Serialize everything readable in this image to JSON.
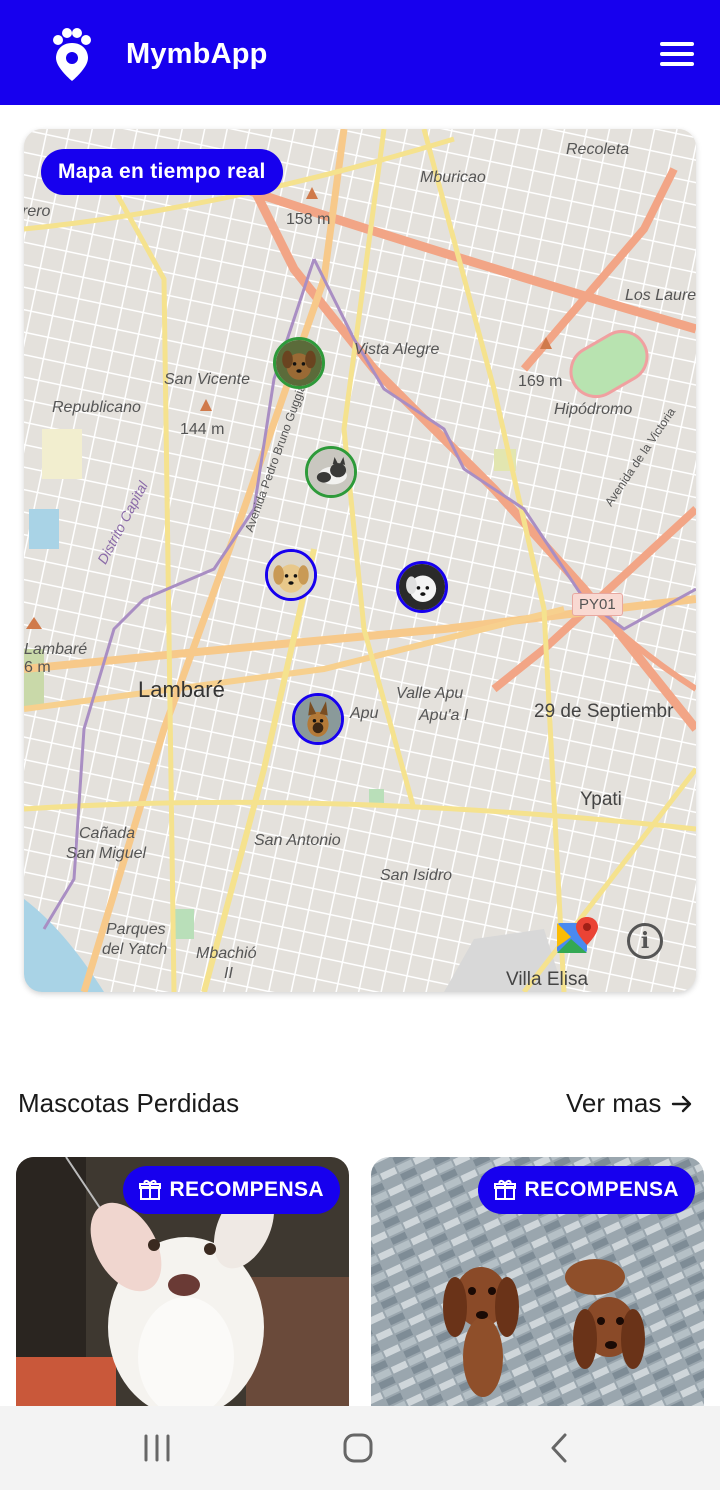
{
  "header": {
    "app_name": "MymbApp",
    "logo_icon": "paw-location-icon",
    "menu_icon": "hamburger-menu-icon"
  },
  "map": {
    "badge": "Mapa en tiempo real",
    "places": {
      "recoleta": "Recoleta",
      "mburicao": "Mburicao",
      "los_laureles": "Los Laure",
      "vista_alegre": "Vista Alegre",
      "san_vicente": "San Vicente",
      "republicano": "Republicano",
      "hipodromo": "Hipódromo",
      "elev_158": "158 m",
      "elev_169": "169 m",
      "elev_144": "144 m",
      "elev_6": "6 m",
      "lambare_small": "Lambaré",
      "lambare": "Lambaré",
      "distrito": "Distrito Capital",
      "av_pedro": "Avenida Pedro Bruno Guggiari",
      "av_victoria": "Avenida de la Victoria",
      "py01": "PY01",
      "valle_apu": "Valle Apu",
      "apua": "Apu'a I",
      "apu": "Apu",
      "sep29": "29 de Septiembr",
      "ypati": "Ypati",
      "canada": "Cañada",
      "san_miguel": "San Miguel",
      "san_antonio": "San Antonio",
      "san_isidro": "San Isidro",
      "parques": "Parques",
      "del_yatch": "del Yatch",
      "mbachio": "Mbachió",
      "mbachio2": "II",
      "villa_elisa": "Villa Elisa",
      "rero": "rero"
    },
    "info_icon": "info-icon",
    "gmaps_icon": "google-maps-icon"
  },
  "lost_pets": {
    "section_title": "Mascotas Perdidas",
    "see_more": "Ver mas",
    "cards": [
      {
        "reward": "RECOMPENSA"
      },
      {
        "reward": "RECOMPENSA"
      }
    ]
  },
  "colors": {
    "primary": "#1700ee",
    "pin_green": "#2e9a3a",
    "pin_blue": "#1700ee"
  }
}
